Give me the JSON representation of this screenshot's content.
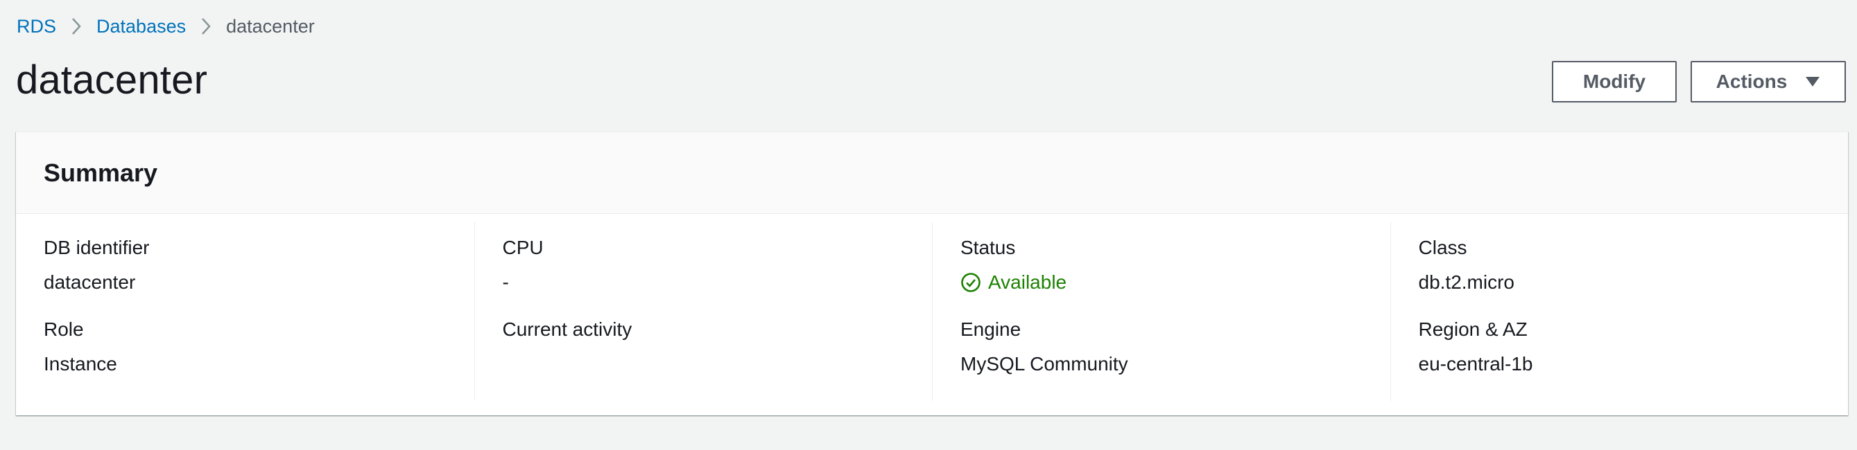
{
  "breadcrumb": {
    "items": [
      {
        "label": "RDS",
        "link": true
      },
      {
        "label": "Databases",
        "link": true
      },
      {
        "label": "datacenter",
        "link": false
      }
    ]
  },
  "header": {
    "title": "datacenter",
    "modify_label": "Modify",
    "actions_label": "Actions"
  },
  "summary": {
    "title": "Summary",
    "columns": [
      [
        {
          "label": "DB identifier",
          "value": "datacenter"
        },
        {
          "label": "Role",
          "value": "Instance"
        }
      ],
      [
        {
          "label": "CPU",
          "value": "-"
        },
        {
          "label": "Current activity",
          "value": ""
        }
      ],
      [
        {
          "label": "Status",
          "value": "Available",
          "status_icon": "check-circle-icon"
        },
        {
          "label": "Engine",
          "value": "MySQL Community"
        }
      ],
      [
        {
          "label": "Class",
          "value": "db.t2.micro"
        },
        {
          "label": "Region & AZ",
          "value": "eu-central-1b"
        }
      ]
    ]
  },
  "colors": {
    "link": "#0073bb",
    "status_ok": "#1d8102",
    "background": "#f2f3f3"
  }
}
